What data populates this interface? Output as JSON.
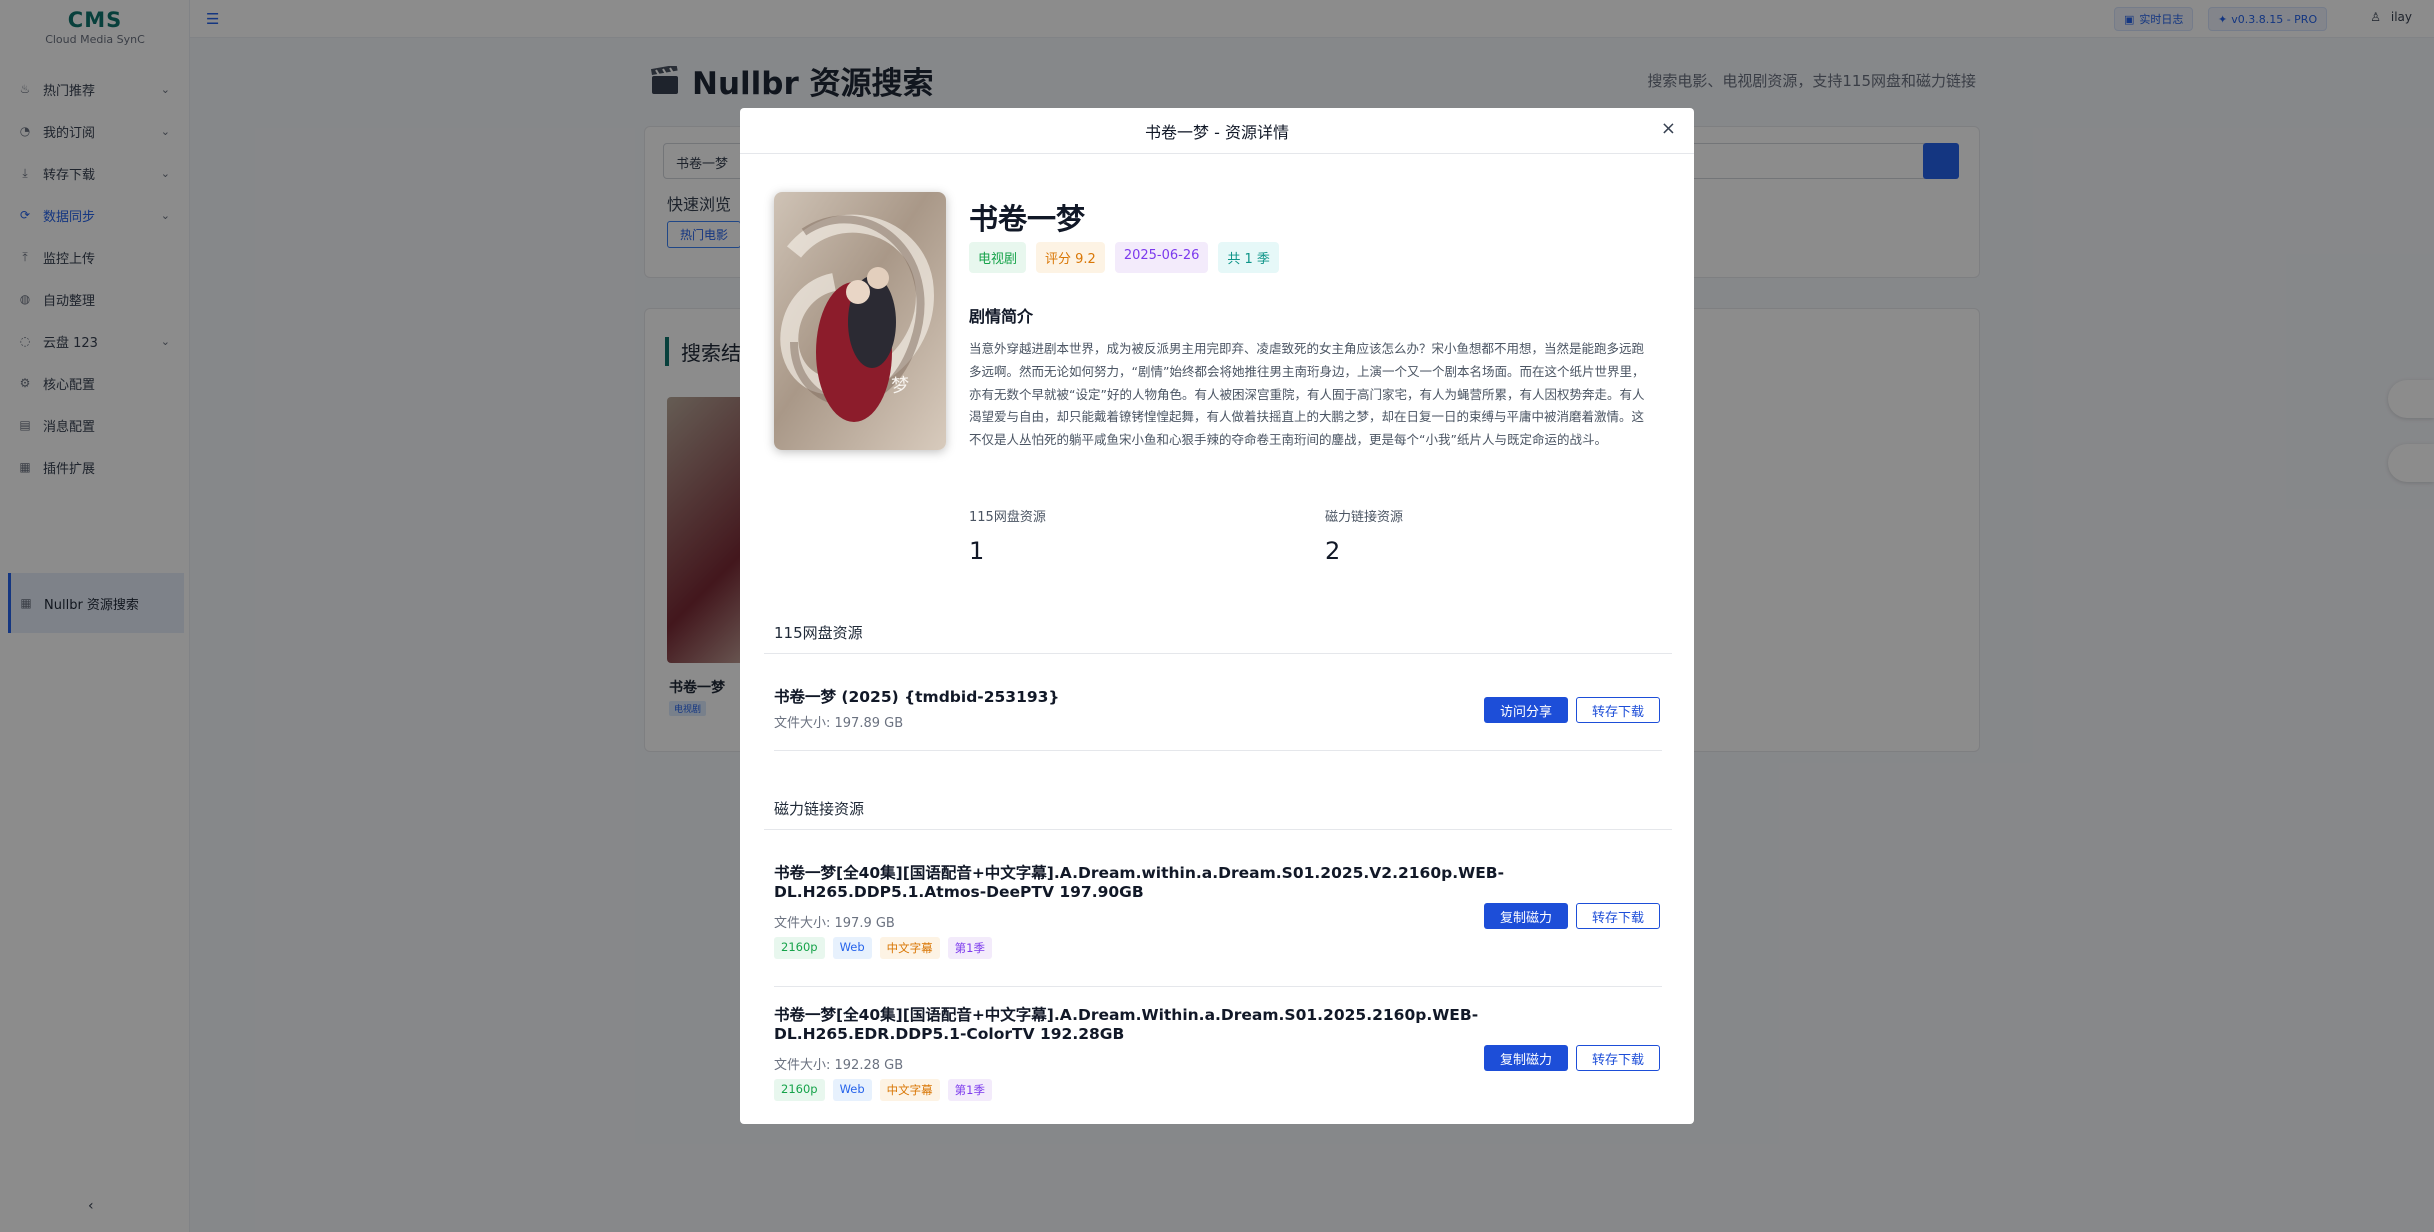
{
  "app": {
    "logo_title": "CMS",
    "logo_subtitle": "Cloud Media SynC"
  },
  "sidebar": {
    "items": [
      {
        "label": "热门推荐",
        "icon": "fire-icon",
        "has_children": true
      },
      {
        "label": "我的订阅",
        "icon": "bell-icon",
        "has_children": true
      },
      {
        "label": "转存下载",
        "icon": "download-icon",
        "has_children": true
      },
      {
        "label": "数据同步",
        "icon": "sync-icon",
        "has_children": true,
        "active": true
      },
      {
        "label": "监控上传",
        "icon": "upload-icon",
        "has_children": false
      },
      {
        "label": "自动整理",
        "icon": "box-icon",
        "has_children": false
      },
      {
        "label": "云盘 123",
        "icon": "cloud-icon",
        "has_children": true
      },
      {
        "label": "核心配置",
        "icon": "gear-icon",
        "has_children": false
      },
      {
        "label": "消息配置",
        "icon": "message-icon",
        "has_children": false
      },
      {
        "label": "插件扩展",
        "icon": "plugin-icon",
        "has_children": false
      }
    ],
    "current": {
      "label": "Nullbr 资源搜索",
      "icon": "grid-icon"
    }
  },
  "topbar": {
    "log_label": "实时日志",
    "version_label": "v0.3.8.15 - PRO",
    "username": "ilay"
  },
  "page": {
    "title": "Nullbr 资源搜索",
    "subtitle": "搜索电影、电视剧资源，支持115网盘和磁力链接",
    "search_value": "书卷一梦",
    "quick_label": "快速浏览",
    "quick_tag": "热门电影",
    "results_title": "搜索结",
    "result_card": {
      "name": "书卷一梦",
      "tag": "电视剧"
    }
  },
  "modal": {
    "header_title": "书卷一梦 - 资源详情",
    "title": "书卷一梦",
    "tags": {
      "type": "电视剧",
      "rating": "评分 9.2",
      "date": "2025-06-26",
      "seasons": "共 1 季"
    },
    "synopsis_heading": "剧情简介",
    "synopsis": "当意外穿越进剧本世界，成为被反派男主用完即弃、凌虐致死的女主角应该怎么办？宋小鱼想都不用想，当然是能跑多远跑多远啊。然而无论如何努力，“剧情”始终都会将她推往男主南珩身边，上演一个又一个剧本名场面。而在这个纸片世界里，亦有无数个早就被“设定”好的人物角色。有人被困深宫重院，有人囿于高门家宅，有人为蝇营所累，有人因权势奔走。有人渴望爱与自由，却只能戴着镣铐惶惶起舞，有人做着扶摇直上的大鹏之梦，却在日复一日的束缚与平庸中被消磨着激情。这不仅是人丛怕死的躺平咸鱼宋小鱼和心狠手辣的夺命卷王南珩间的鏖战，更是每个“小我”纸片人与既定命运的战斗。",
    "stats": {
      "pan115_label": "115网盘资源",
      "pan115_count": "1",
      "magnet_label": "磁力链接资源",
      "magnet_count": "2"
    },
    "pan115_section_title": "115网盘资源",
    "pan115_items": [
      {
        "name": "书卷一梦 (2025) {tmdbid-253193}",
        "size": "文件大小: 197.89 GB",
        "visit_label": "访问分享",
        "save_label": "转存下载"
      }
    ],
    "magnet_section_title": "磁力链接资源",
    "magnet_items": [
      {
        "name_line1": "书卷一梦[全40集][国语配音+中文字幕].A.Dream.within.a.Dream.S01.2025.V2.2160p.WEB-",
        "name_line2": "DL.H265.DDP5.1.Atmos-DeePTV 197.90GB",
        "size": "文件大小: 197.9 GB",
        "tags": [
          "2160p",
          "Web",
          "中文字幕",
          "第1季"
        ],
        "copy_label": "复制磁力",
        "save_label": "转存下载"
      },
      {
        "name_line1": "书卷一梦[全40集][国语配音+中文字幕].A.Dream.Within.a.Dream.S01.2025.2160p.WEB-",
        "name_line2": "DL.H265.EDR.DDP5.1-ColorTV 192.28GB",
        "size": "文件大小: 192.28 GB",
        "tags": [
          "2160p",
          "Web",
          "中文字幕",
          "第1季"
        ],
        "copy_label": "复制磁力",
        "save_label": "转存下载"
      }
    ]
  }
}
